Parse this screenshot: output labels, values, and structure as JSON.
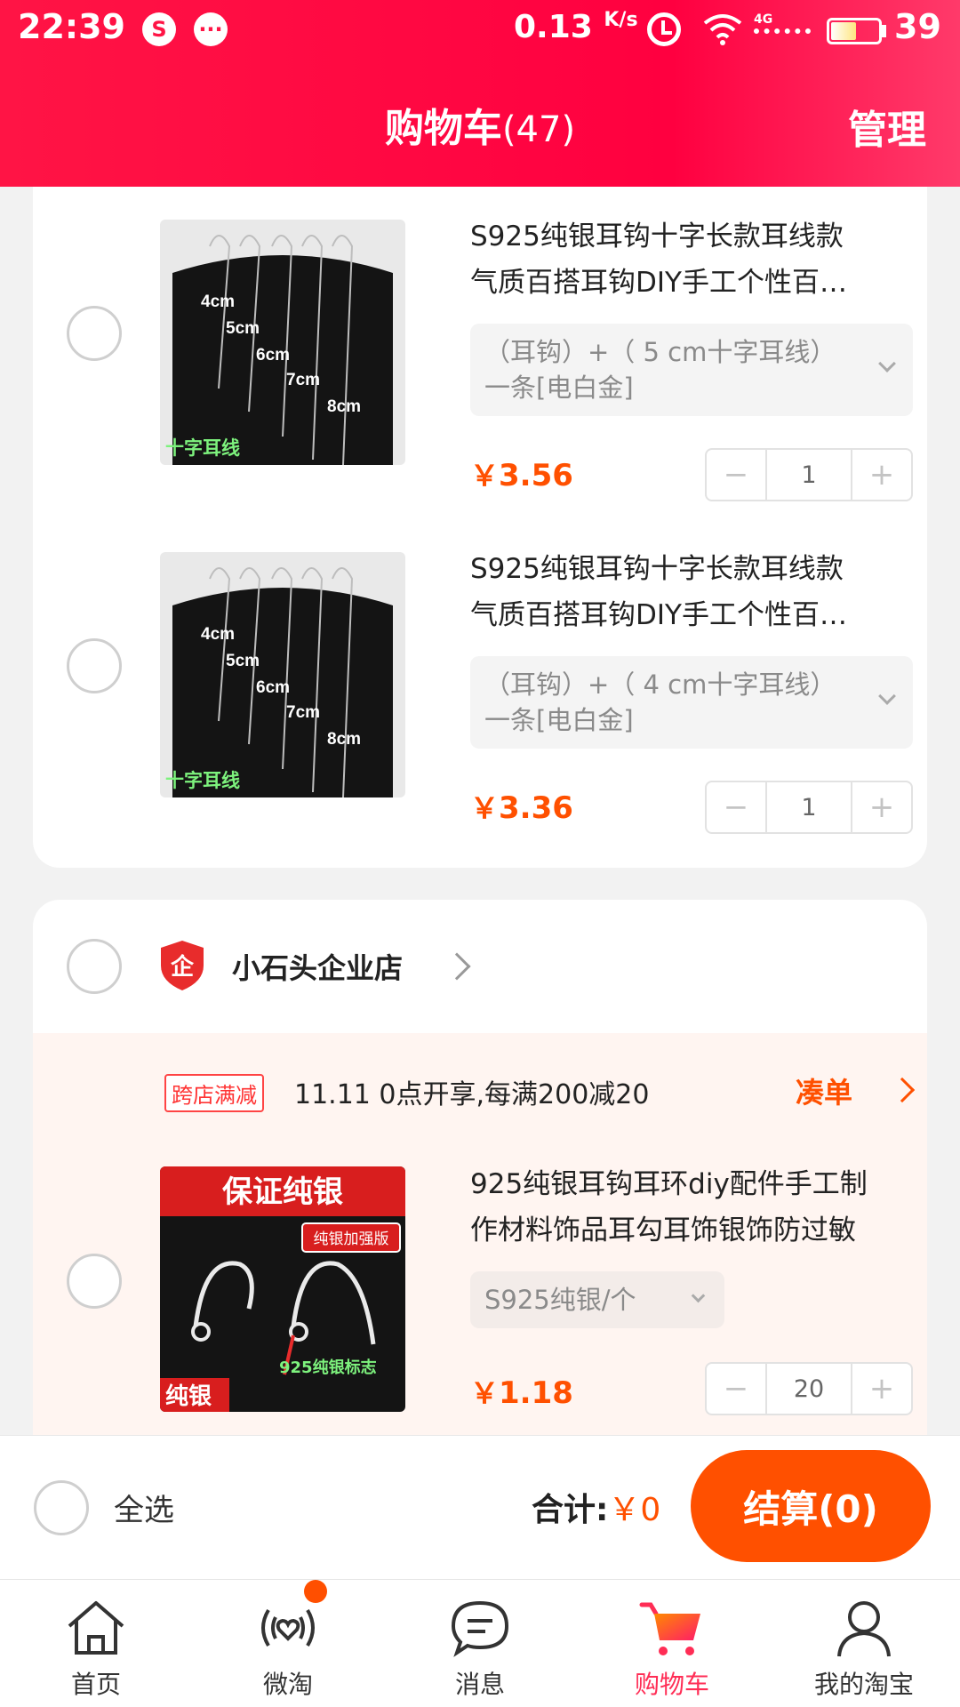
{
  "status_bar": {
    "time": "22:39",
    "speed": "0.13",
    "speed_unit": "K/s",
    "network": "4G",
    "battery": "39"
  },
  "header": {
    "title": "购物车",
    "count": "(47)",
    "manage": "管理"
  },
  "store1_items": [
    {
      "title_line1": "S925纯银耳钩十字长款耳线款",
      "title_line2": "气质百搭耳钩DIY手工个性百…",
      "sku": "（耳钩）+（ 5 cm十字耳线）一条[电白金]",
      "price": "3.56",
      "quantity": "1",
      "image_caption": "十字耳线",
      "image_labels": [
        "4cm",
        "5cm",
        "6cm",
        "7cm",
        "8cm"
      ]
    },
    {
      "title_line1": "S925纯银耳钩十字长款耳线款",
      "title_line2": "气质百搭耳钩DIY手工个性百…",
      "sku": "（耳钩）+（ 4 cm十字耳线）一条[电白金]",
      "price": "3.36",
      "quantity": "1",
      "image_caption": "十字耳线",
      "image_labels": [
        "4cm",
        "5cm",
        "6cm",
        "7cm",
        "8cm"
      ]
    }
  ],
  "store2": {
    "name": "小石头企业店",
    "badge_char": "企",
    "promo_tag": "跨店满减",
    "promo_text": "11.11 0点开享,每满200减20",
    "promo_link": "凑单",
    "item": {
      "title_line1": "925纯银耳钩耳环diy配件手工制",
      "title_line2": "作材料饰品耳勾耳饰银饰防过敏",
      "sku": "S925纯银/个",
      "price": "1.18",
      "quantity": "20",
      "image_banner": "保证纯银",
      "image_stamp": "纯银加强版",
      "image_mark": "925纯银标志",
      "image_corner": "纯银"
    }
  },
  "currency_symbol": "￥",
  "stepper": {
    "minus": "−",
    "plus": "+"
  },
  "bottom_bar": {
    "select_all": "全选",
    "total_label": "合计:",
    "total_value": "￥0",
    "checkout": "结算(0)"
  },
  "tabs": [
    {
      "label": "首页",
      "icon": "home-icon"
    },
    {
      "label": "微淘",
      "icon": "weitao-icon"
    },
    {
      "label": "消息",
      "icon": "message-icon"
    },
    {
      "label": "购物车",
      "icon": "cart-icon",
      "active": true
    },
    {
      "label": "我的淘宝",
      "icon": "profile-icon"
    }
  ],
  "colors": {
    "header": "#ff1445",
    "price": "#ff5000",
    "active_tab": "#ff2d55",
    "checkout": "#ff5000"
  }
}
